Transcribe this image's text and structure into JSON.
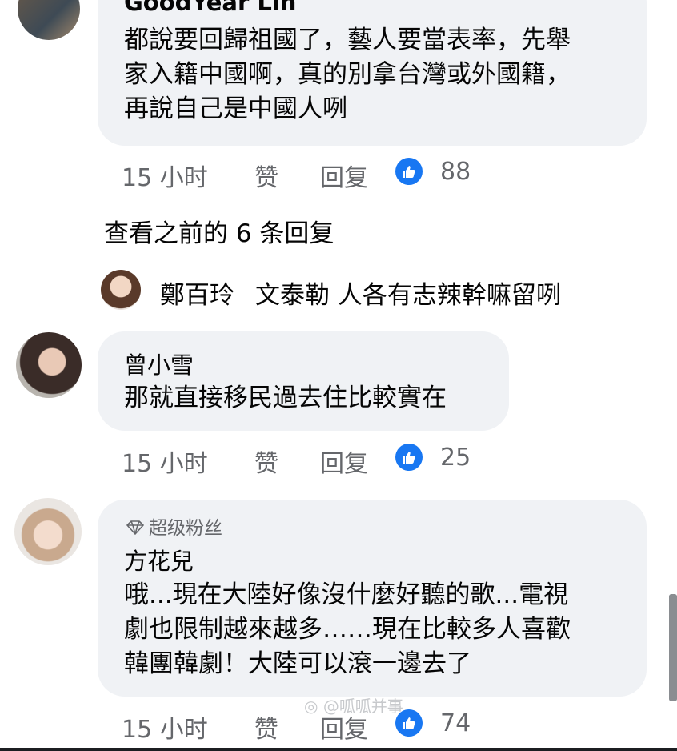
{
  "comments": [
    {
      "author": "GoodYear Lin",
      "lines": [
        "都說要回歸祖國了，藝人要當表率，先舉",
        "家入籍中國啊，真的別拿台灣或外國籍，",
        "再說自己是中國人咧"
      ],
      "time": "15 小时",
      "like_label": "赞",
      "reply_label": "回复",
      "likes": "88"
    },
    {
      "author": "曾小雪",
      "lines": [
        "那就直接移民過去住比較實在"
      ],
      "time": "15 小时",
      "like_label": "赞",
      "reply_label": "回复",
      "likes": "25"
    },
    {
      "badge": "超级粉丝",
      "author": "方花兒",
      "lines": [
        "哦...現在大陸好像沒什麼好聽的歌...電視",
        "劇也限制越來越多……現在比較多人喜歡",
        "韓團韓劇！大陸可以滾一邊去了"
      ],
      "time": "15 小时",
      "like_label": "赞",
      "reply_label": "回复",
      "likes": "74"
    }
  ],
  "view_previous": "查看之前的 6 条回复",
  "reply_preview": {
    "author": "鄭百玲",
    "text": "文泰勒 人各有志辣幹嘛留咧"
  },
  "watermark": "@呱呱并事",
  "colors": {
    "like_blue": "#1877f2",
    "bubble": "#f0f2f5",
    "meta_gray": "#65676b"
  }
}
